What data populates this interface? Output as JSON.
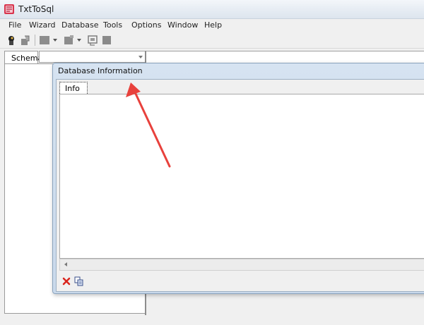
{
  "window": {
    "title": "TxtToSql",
    "icon": "app-icon"
  },
  "menu": {
    "items": [
      "File",
      "Wizard",
      "Database",
      "Tools",
      "Options",
      "Window",
      "Help"
    ]
  },
  "toolbar": {
    "icons": [
      "connect-icon",
      "disconnect-icon",
      "table-icon",
      "dropdown-arrow-icon",
      "import-icon",
      "dropdown-arrow-icon",
      "sql-icon",
      "stop-icon"
    ]
  },
  "schema_panel": {
    "tab_label": "Schema",
    "combo_value": ""
  },
  "db_window": {
    "title": "Database Information",
    "tab_label": "Info",
    "bottom_icons": [
      "delete-icon",
      "copy-icon"
    ]
  },
  "colors": {
    "annotation_arrow": "#e8413c",
    "window_frame": "#c9d9eb"
  }
}
